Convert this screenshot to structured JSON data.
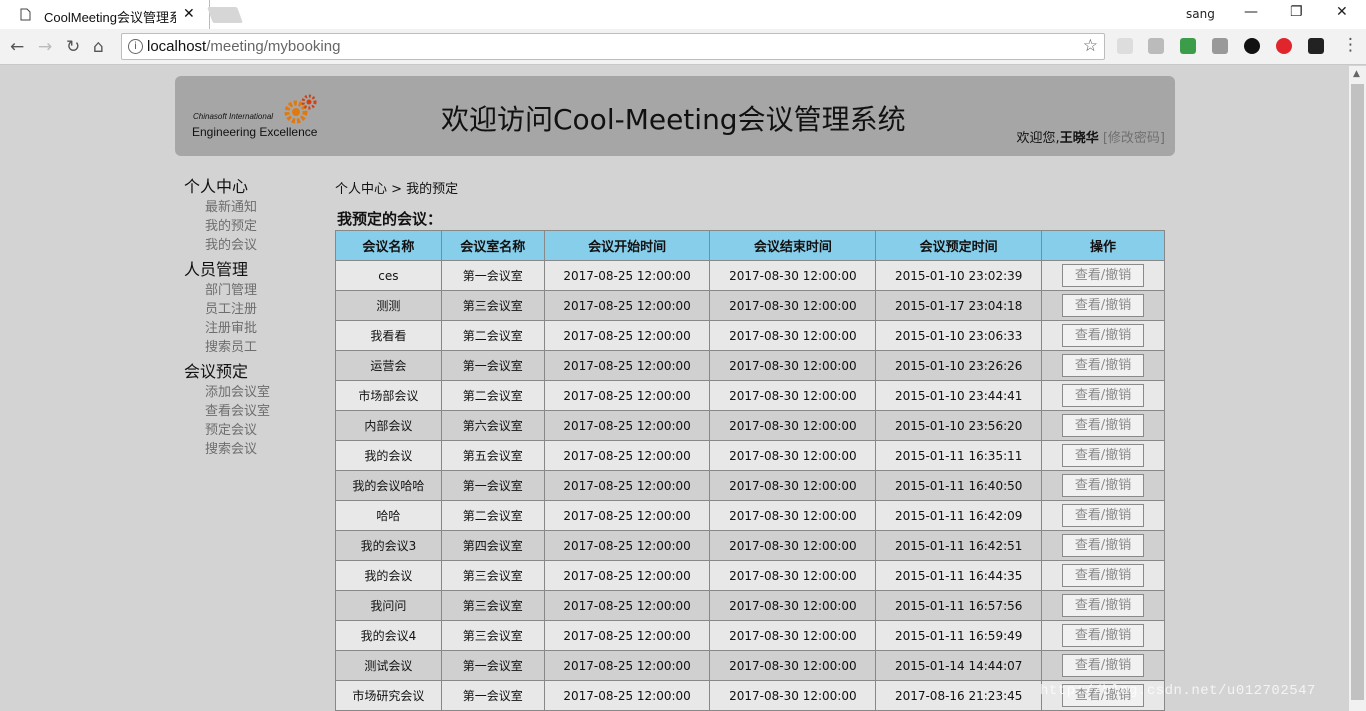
{
  "browser": {
    "tab_title": "CoolMeeting会议管理系",
    "user_label": "sang",
    "url_host": "localhost",
    "url_path": "/meeting/mybooking"
  },
  "header": {
    "logo_line1": "Chinasoft International",
    "logo_line2": "Engineering Excellence",
    "title": "欢迎访问Cool-Meeting会议管理系统",
    "welcome_prefix": "欢迎您,",
    "user_name": "王晓华",
    "change_password": "[修改密码]"
  },
  "nav": [
    {
      "title": "个人中心",
      "items": [
        "最新通知",
        "我的预定",
        "我的会议"
      ]
    },
    {
      "title": "人员管理",
      "items": [
        "部门管理",
        "员工注册",
        "注册审批",
        "搜索员工"
      ]
    },
    {
      "title": "会议预定",
      "items": [
        "添加会议室",
        "查看会议室",
        "预定会议",
        "搜索会议"
      ]
    }
  ],
  "breadcrumb": "个人中心 > 我的预定",
  "heading": "我预定的会议：",
  "table": {
    "columns": [
      "会议名称",
      "会议室名称",
      "会议开始时间",
      "会议结束时间",
      "会议预定时间",
      "操作"
    ],
    "action_label": "查看/撤销",
    "rows": [
      [
        "ces",
        "第一会议室",
        "2017-08-25 12:00:00",
        "2017-08-30 12:00:00",
        "2015-01-10 23:02:39"
      ],
      [
        "测测",
        "第三会议室",
        "2017-08-25 12:00:00",
        "2017-08-30 12:00:00",
        "2015-01-17 23:04:18"
      ],
      [
        "我看看",
        "第二会议室",
        "2017-08-25 12:00:00",
        "2017-08-30 12:00:00",
        "2015-01-10 23:06:33"
      ],
      [
        "运营会",
        "第一会议室",
        "2017-08-25 12:00:00",
        "2017-08-30 12:00:00",
        "2015-01-10 23:26:26"
      ],
      [
        "市场部会议",
        "第二会议室",
        "2017-08-25 12:00:00",
        "2017-08-30 12:00:00",
        "2015-01-10 23:44:41"
      ],
      [
        "内部会议",
        "第六会议室",
        "2017-08-25 12:00:00",
        "2017-08-30 12:00:00",
        "2015-01-10 23:56:20"
      ],
      [
        "我的会议",
        "第五会议室",
        "2017-08-25 12:00:00",
        "2017-08-30 12:00:00",
        "2015-01-11 16:35:11"
      ],
      [
        "我的会议哈哈",
        "第一会议室",
        "2017-08-25 12:00:00",
        "2017-08-30 12:00:00",
        "2015-01-11 16:40:50"
      ],
      [
        "哈哈",
        "第二会议室",
        "2017-08-25 12:00:00",
        "2017-08-30 12:00:00",
        "2015-01-11 16:42:09"
      ],
      [
        "我的会议3",
        "第四会议室",
        "2017-08-25 12:00:00",
        "2017-08-30 12:00:00",
        "2015-01-11 16:42:51"
      ],
      [
        "我的会议",
        "第三会议室",
        "2017-08-25 12:00:00",
        "2017-08-30 12:00:00",
        "2015-01-11 16:44:35"
      ],
      [
        "我问问",
        "第三会议室",
        "2017-08-25 12:00:00",
        "2017-08-30 12:00:00",
        "2015-01-11 16:57:56"
      ],
      [
        "我的会议4",
        "第三会议室",
        "2017-08-25 12:00:00",
        "2017-08-30 12:00:00",
        "2015-01-11 16:59:49"
      ],
      [
        "测试会议",
        "第一会议室",
        "2017-08-25 12:00:00",
        "2017-08-30 12:00:00",
        "2015-01-14 14:44:07"
      ],
      [
        "市场研究会议",
        "第一会议室",
        "2017-08-25 12:00:00",
        "2017-08-30 12:00:00",
        "2017-08-16 21:23:45"
      ]
    ]
  },
  "watermark": "http://blog.csdn.net/u012702547",
  "colors": {
    "header_bg": "#a6a6a6",
    "table_header_bg": "#87ceeb",
    "page_bg": "#d3d3d3"
  },
  "icons": [
    "document-icon",
    "close-icon",
    "back-icon",
    "forward-icon",
    "reload-icon",
    "home-icon",
    "info-icon",
    "star-icon",
    "minimize-icon",
    "maximize-icon",
    "window-close-icon",
    "gear-logo-icon"
  ]
}
